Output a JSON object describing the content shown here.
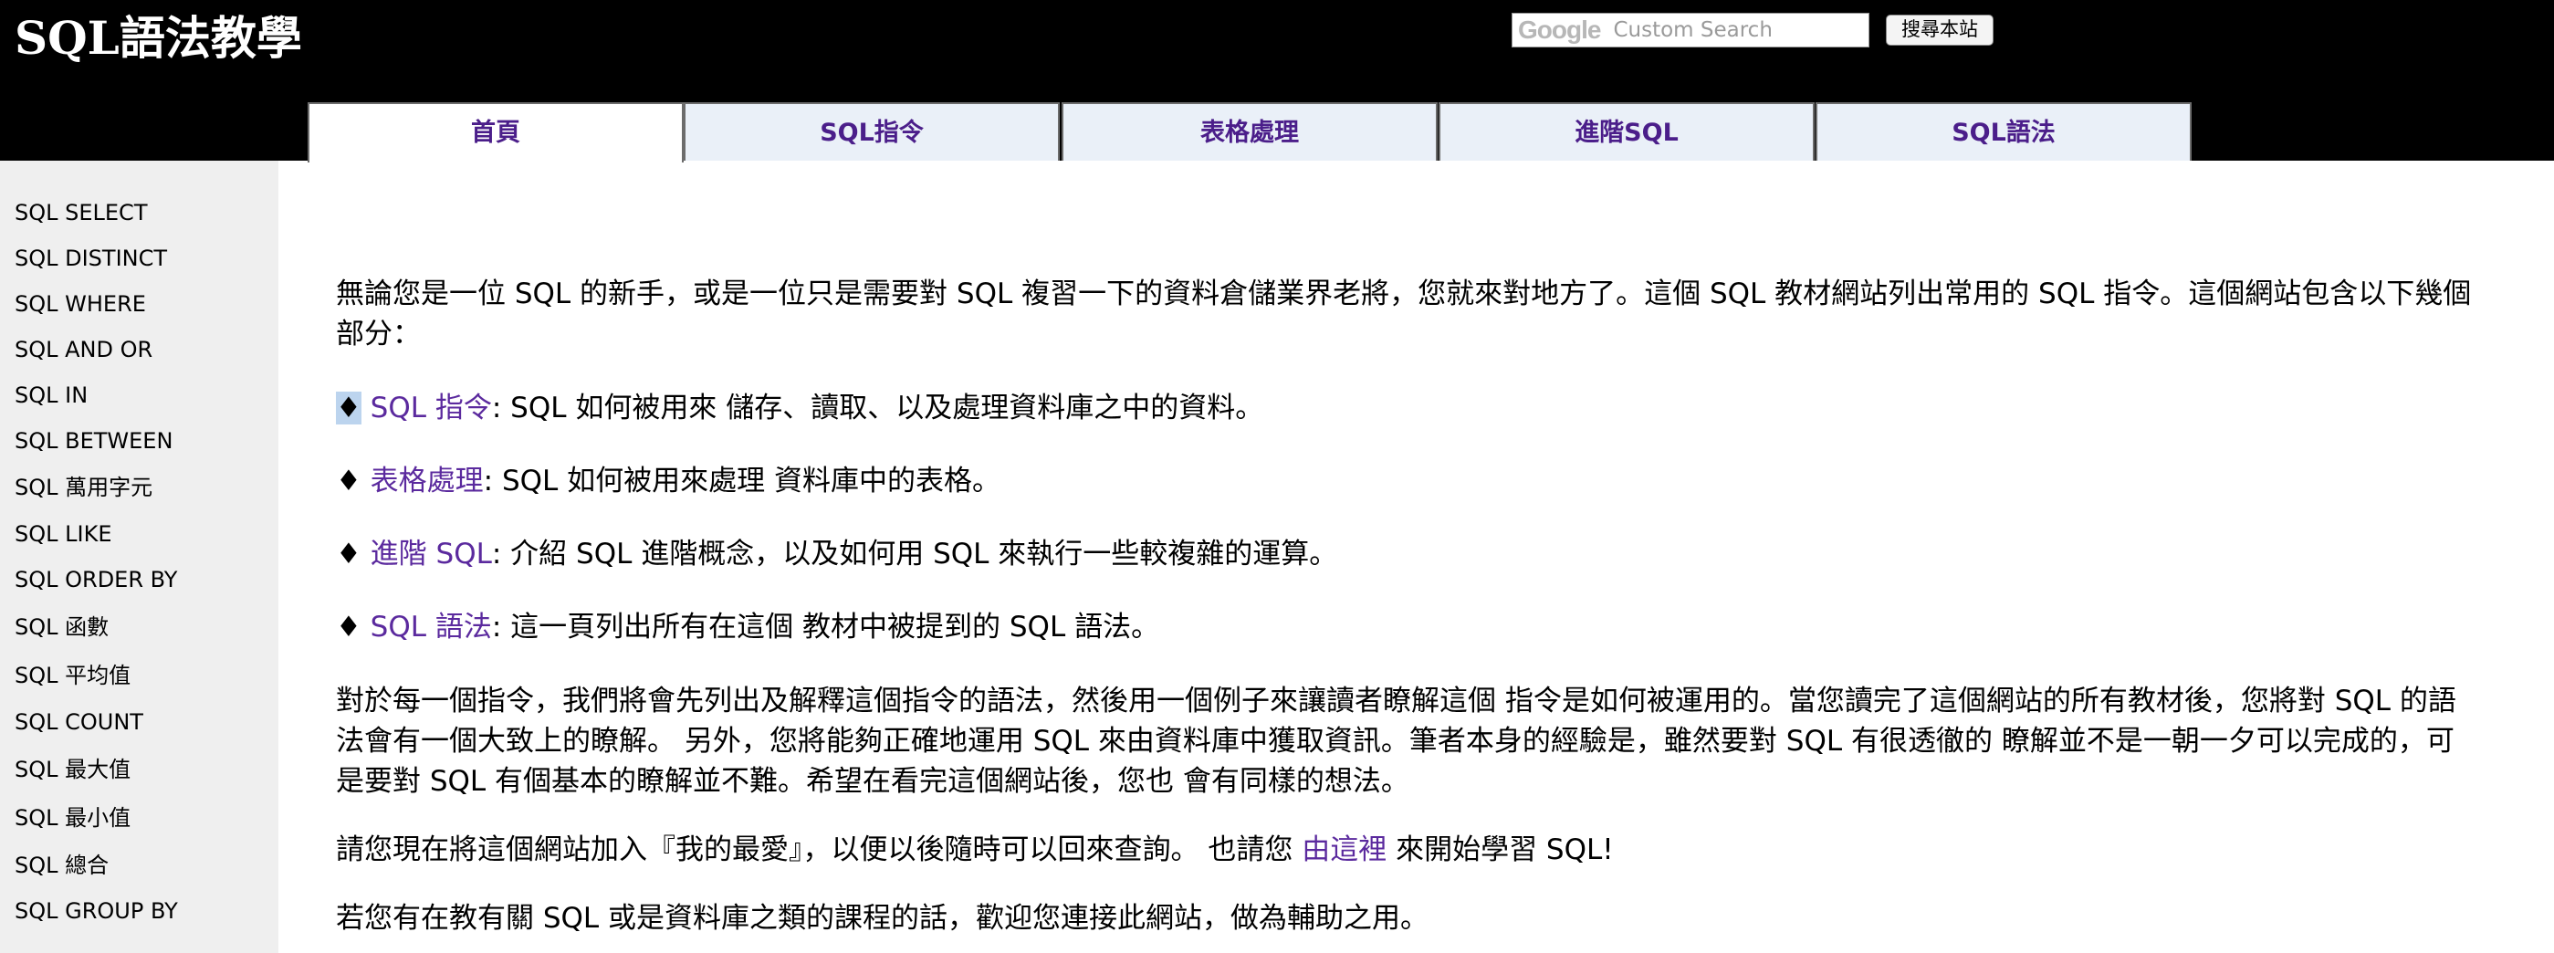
{
  "header": {
    "site_title": "SQL語法教學",
    "search": {
      "logo_text": "Google",
      "placeholder": "Custom Search",
      "button_label": "搜尋本站"
    }
  },
  "tabs": [
    {
      "label": "首頁",
      "active": true
    },
    {
      "label": "SQL指令",
      "active": false
    },
    {
      "label": "表格處理",
      "active": false
    },
    {
      "label": "進階SQL",
      "active": false
    },
    {
      "label": "SQL語法",
      "active": false
    }
  ],
  "sidebar": {
    "items": [
      {
        "label": "SQL SELECT"
      },
      {
        "label": "SQL DISTINCT"
      },
      {
        "label": "SQL WHERE"
      },
      {
        "label": "SQL AND OR"
      },
      {
        "label": "SQL IN"
      },
      {
        "label": "SQL BETWEEN"
      },
      {
        "label": "SQL 萬用字元"
      },
      {
        "label": "SQL LIKE"
      },
      {
        "label": "SQL ORDER BY"
      },
      {
        "label": "SQL 函數"
      },
      {
        "label": "SQL 平均值"
      },
      {
        "label": "SQL COUNT"
      },
      {
        "label": "SQL 最大值"
      },
      {
        "label": "SQL 最小值"
      },
      {
        "label": "SQL 總合"
      },
      {
        "label": "SQL GROUP BY"
      }
    ]
  },
  "main": {
    "intro": "無論您是一位 SQL 的新手，或是一位只是需要對 SQL 複習一下的資料倉儲業界老將，您就來對地方了。這個 SQL 教材網站列出常用的 SQL 指令。這個網站包含以下幾個部分：",
    "sections": [
      {
        "bullet": "♦",
        "link": "SQL 指令",
        "desc": ": SQL 如何被用來 儲存、讀取、以及處理資料庫之中的資料。"
      },
      {
        "bullet": "♦",
        "link": "表格處理",
        "desc": ": SQL 如何被用來處理 資料庫中的表格。"
      },
      {
        "bullet": "♦",
        "link": "進階 SQL",
        "desc": ": 介紹 SQL 進階概念，以及如何用 SQL 來執行一些較複雜的運算。"
      },
      {
        "bullet": "♦",
        "link": "SQL 語法",
        "desc": ": 這一頁列出所有在這個 教材中被提到的 SQL 語法。"
      }
    ],
    "para2": "對於每一個指令，我們將會先列出及解釋這個指令的語法，然後用一個例子來讓讀者瞭解這個 指令是如何被運用的。當您讀完了這個網站的所有教材後，您將對 SQL 的語法會有一個大致上的瞭解。 另外，您將能夠正確地運用 SQL 來由資料庫中獲取資訊。筆者本身的經驗是，雖然要對 SQL 有很透徹的 瞭解並不是一朝一夕可以完成的，可是要對 SQL 有個基本的瞭解並不難。希望在看完這個網站後，您也 會有同樣的想法。",
    "para3": {
      "before": "請您現在將這個網站加入『我的最愛』，以便以後隨時可以回來查詢。 也請您 ",
      "link": "由這裡",
      "after": " 來開始學習 SQL!"
    },
    "para4": "若您有在教有關 SQL 或是資料庫之類的課程的話，歡迎您連接此網站，做為輔助之用。"
  }
}
